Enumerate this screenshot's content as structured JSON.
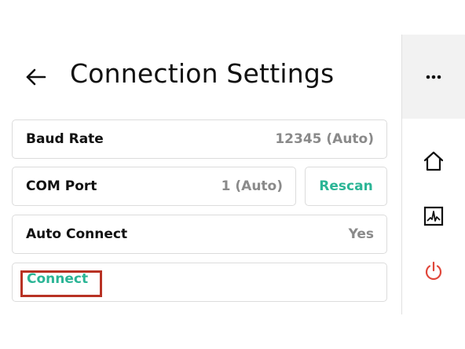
{
  "header": {
    "title": "Connection Settings"
  },
  "settings": {
    "baud_rate": {
      "label": "Baud Rate",
      "value": "12345 (Auto)"
    },
    "com_port": {
      "label": "COM Port",
      "value": "1 (Auto)",
      "rescan_label": "Rescan"
    },
    "auto_connect": {
      "label": "Auto Connect",
      "value": "Yes"
    },
    "connect_label": "Connect"
  },
  "sidebar": {
    "icons": [
      "more-icon",
      "home-icon",
      "chart-icon",
      "power-icon"
    ]
  },
  "colors": {
    "accent": "#2bb596",
    "value_gray": "#8a8a8a",
    "highlight_red": "#b83224",
    "power_red": "#e0463a",
    "sidebar_bg": "#f2f2f2"
  }
}
